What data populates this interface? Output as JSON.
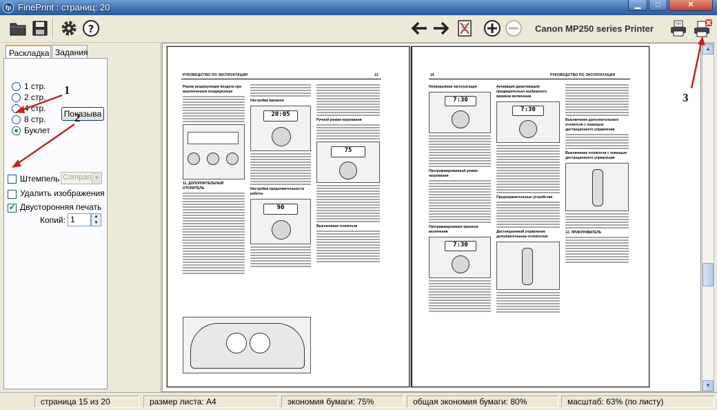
{
  "window": {
    "title": "FinePrint : страниц: 20",
    "app_icon": "fp",
    "controls": {
      "minimize": "minimize-icon",
      "maximize": "maximize-icon",
      "close": "close-icon"
    }
  },
  "toolbar": {
    "buttons": [
      "open-folder-icon",
      "save-icon",
      "settings-gear-icon",
      "help-icon",
      "previous-arrow-icon",
      "next-arrow-icon",
      "delete-page-icon",
      "zoom-in-icon",
      "zoom-out-icon"
    ],
    "printer_name": "Canon MP250 series Printer",
    "print_buttons": [
      "print-icon",
      "print-and-close-icon"
    ]
  },
  "tabs": {
    "layout": "Раскладка",
    "jobs": "Задания"
  },
  "layout_options": {
    "items": [
      "1 стр.",
      "2 стр.",
      "4 стр.",
      "8 стр.",
      "Буклет"
    ],
    "selected": "Буклет",
    "show_button": "Показыва"
  },
  "options": {
    "stamp_label": "Штемпель",
    "stamp_select": "Compan",
    "stamp_checked": false,
    "remove_images_label": "Удалить изображения",
    "remove_images_checked": false,
    "duplex_label": "Двусторонняя печать",
    "duplex_checked": true,
    "copies_label": "Копий:",
    "copies_value": "1"
  },
  "preview": {
    "left_page": {
      "running_head": "РУКОВОДСТВО ПО ЭКСПЛУАТАЦИИ",
      "page_number": "13",
      "headings": [
        "Режим рециркуляции воздуха при выключенном кондиционере",
        "Настройка времени",
        "11. ДОПОЛНИТЕЛЬНЫЙ ОТОПИТЕЛЬ",
        "Настройка продолжительности работы",
        "Ручной режим нагревания",
        "Выключение отопителя"
      ],
      "lcd_values": [
        "20:05",
        "75",
        "90"
      ]
    },
    "right_page": {
      "running_head": "РУКОВОДСТВО ПО ЭКСПЛУАТАЦИИ",
      "page_number": "14",
      "headings": [
        "Непрерывная эксплуатация",
        "Активация (деактивация) предварительно выбранного времени включения",
        "Выключение дополнительного отопителя с помощью дистанционного управления",
        "Программированный режим нагревания",
        "Выключение отопителя с помощью дистанционного управления",
        "Программирование времени включения",
        "Предохранительные устройства",
        "Дистанционный управление дополнительным отопителем",
        "12. ПРИКУРИВАТЕЛЬ"
      ],
      "lcd_values": [
        "7:30",
        "7:30",
        "7:30"
      ]
    }
  },
  "annotations": [
    "1",
    "2",
    "3"
  ],
  "status": {
    "page": "страница 15 из 20",
    "sheet_size": "размер листа: А4",
    "paper_saving": "экономия бумаги: 75%",
    "total_saving": "общая экономия бумаги: 80%",
    "zoom": "масштаб: 63% (по листу)"
  }
}
